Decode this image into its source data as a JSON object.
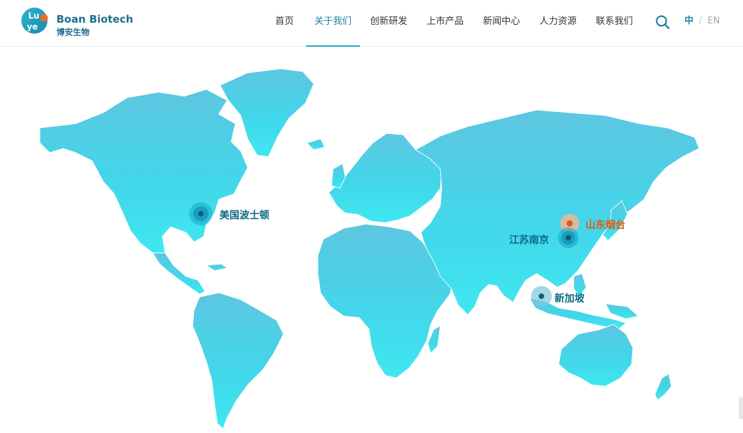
{
  "brand": {
    "badge_text": "Lu ye",
    "name_en": "Boan Biotech",
    "name_cn": "博安生物",
    "colors": {
      "primary": "#1d6f8f",
      "accent": "#e8560f",
      "map": "#4fd3e6"
    }
  },
  "nav": {
    "items": [
      {
        "label": "首页"
      },
      {
        "label": "关于我们"
      },
      {
        "label": "创新研发"
      },
      {
        "label": "上市产品"
      },
      {
        "label": "新闻中心"
      },
      {
        "label": "人力资源"
      },
      {
        "label": "联系我们"
      }
    ],
    "active_index": 1,
    "search_icon": "search-icon"
  },
  "lang": {
    "cn": "中",
    "separator": "/",
    "en": "EN"
  },
  "map": {
    "locations": [
      {
        "label": "美国波士顿"
      },
      {
        "label": "山东烟台",
        "headquarters": true
      },
      {
        "label": "江苏南京"
      },
      {
        "label": "新加坡"
      }
    ]
  }
}
